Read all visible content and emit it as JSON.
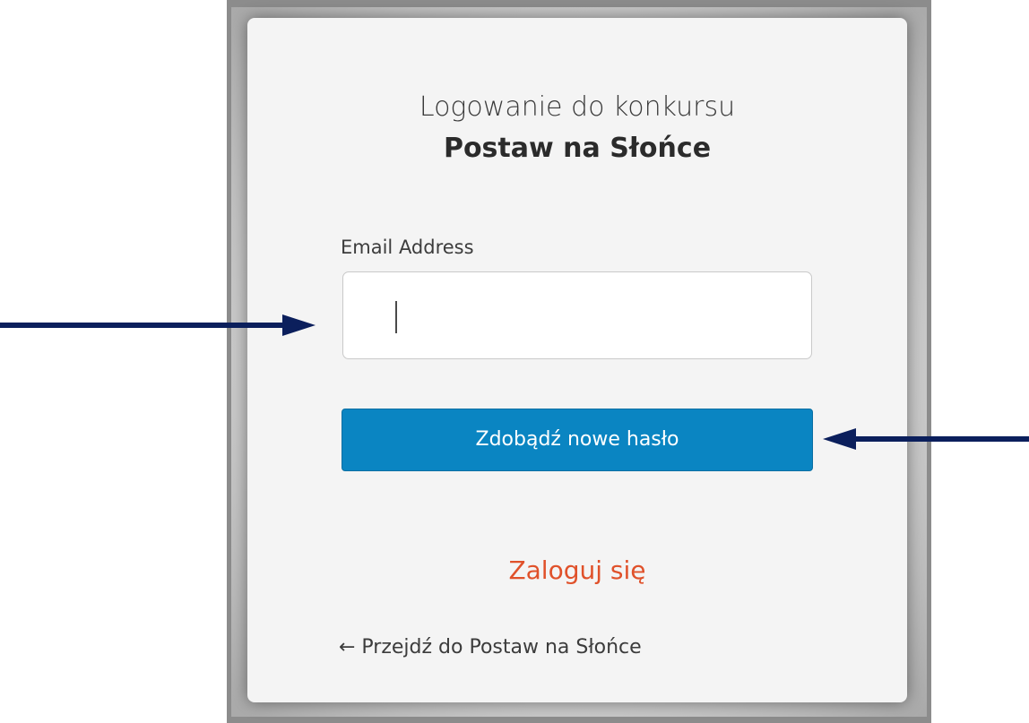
{
  "header": {
    "title_line1": "Logowanie do konkursu",
    "title_line2": "Postaw na Słońce"
  },
  "form": {
    "email_label": "Email Address",
    "email_value": "",
    "submit_label": "Zdobądź nowe hasło"
  },
  "links": {
    "login": "Zaloguj się",
    "back": "← Przejdź do Postaw na Słońce"
  },
  "colors": {
    "accent": "#0a85c2",
    "link": "#e0512a",
    "arrow": "#0b1f5c",
    "card_bg": "#f4f4f4"
  },
  "icons": {
    "annotation_arrow_left": "arrow-right-icon",
    "annotation_arrow_right": "arrow-left-icon"
  }
}
